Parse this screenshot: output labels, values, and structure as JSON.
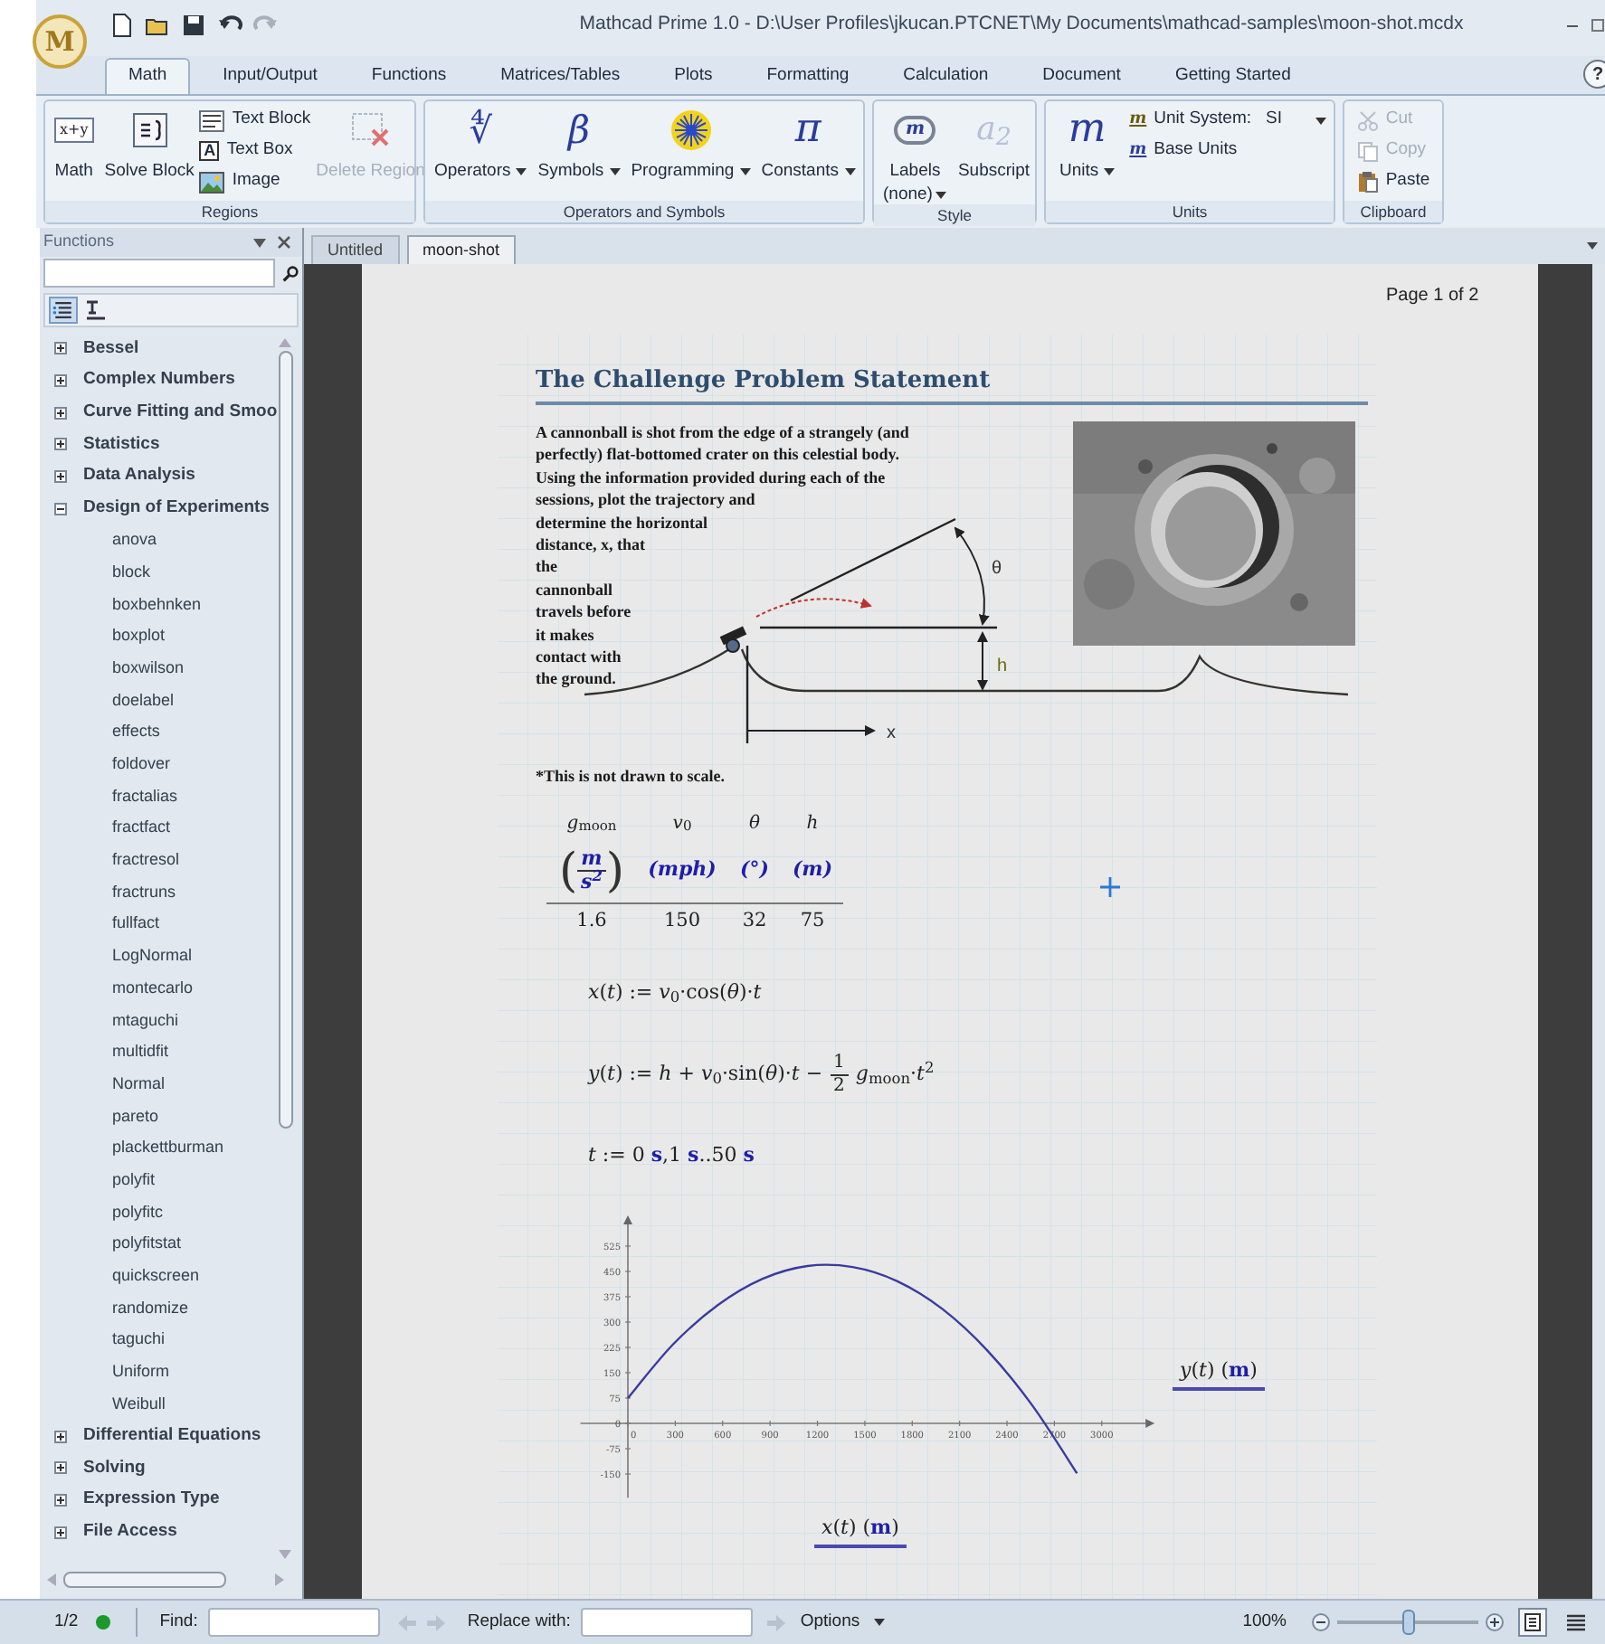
{
  "window": {
    "logo": "M",
    "title": "Mathcad Prime 1.0 - D:\\User Profiles\\jkucan.PTCNET\\My Documents\\mathcad-samples\\moon-shot.mcdx"
  },
  "quick_access": [
    {
      "kind": "new",
      "disabled": false
    },
    {
      "kind": "open",
      "disabled": false
    },
    {
      "kind": "save",
      "disabled": false
    },
    {
      "kind": "undo",
      "disabled": false
    },
    {
      "kind": "redo",
      "disabled": true
    }
  ],
  "ribbon_tabs": [
    {
      "label": "Math",
      "selected": true
    },
    {
      "label": "Input/Output",
      "selected": false
    },
    {
      "label": "Functions",
      "selected": false
    },
    {
      "label": "Matrices/Tables",
      "selected": false
    },
    {
      "label": "Plots",
      "selected": false
    },
    {
      "label": "Formatting",
      "selected": false
    },
    {
      "label": "Calculation",
      "selected": false
    },
    {
      "label": "Document",
      "selected": false
    },
    {
      "label": "Getting Started",
      "selected": false
    }
  ],
  "help": "?",
  "ribbon_groups": [
    {
      "label": "Regions",
      "items": [
        {
          "kind": "large",
          "glyph": "x+y",
          "label": "Math",
          "disabled": false,
          "dropdown": false
        },
        {
          "kind": "large",
          "label": "Solve Block",
          "disabled": false,
          "dropdown": false
        },
        {
          "kind": "stack",
          "items": [
            {
              "label": "Text Block",
              "disabled": false,
              "dropdown": false
            },
            {
              "glyph": "A",
              "label": "Text Box",
              "disabled": false,
              "dropdown": false
            },
            {
              "label": "Image",
              "disabled": false,
              "dropdown": false
            }
          ]
        },
        {
          "kind": "large",
          "label": "Delete Region",
          "disabled": true,
          "dropdown": false
        }
      ]
    },
    {
      "label": "Operators and Symbols",
      "items": [
        {
          "kind": "large",
          "glyph": "∜",
          "label": "Operators",
          "disabled": false,
          "dropdown": true
        },
        {
          "kind": "large",
          "glyph": "β",
          "label": "Symbols",
          "disabled": false,
          "dropdown": true
        },
        {
          "kind": "large",
          "label": "Programming",
          "disabled": false,
          "dropdown": true
        },
        {
          "kind": "large",
          "glyph": "π",
          "label": "Constants",
          "disabled": false,
          "dropdown": true
        }
      ]
    },
    {
      "label": "Style",
      "items": [
        {
          "kind": "large",
          "glyph": "m",
          "label": "Labels",
          "value": "(none)",
          "disabled": false,
          "dropdown": true
        },
        {
          "kind": "large",
          "glyph": "a$_{2}$",
          "label": "Subscript",
          "disabled": false,
          "dropdown": false
        }
      ]
    },
    {
      "label": "Units",
      "items": [
        {
          "kind": "large",
          "glyph": "m",
          "label": "Units",
          "disabled": false,
          "dropdown": true
        },
        {
          "kind": "stack",
          "items": [
            {
              "glyph": "m",
              "label": "Unit System:",
              "value": "SI",
              "disabled": false,
              "dropdown": true
            },
            {
              "glyph": "m",
              "label": "Base Units",
              "disabled": false,
              "dropdown": false
            }
          ]
        }
      ]
    },
    {
      "label": "Clipboard",
      "items": [
        {
          "kind": "stack",
          "items": [
            {
              "label": "Cut",
              "disabled": true,
              "dropdown": false
            },
            {
              "label": "Copy",
              "disabled": true,
              "dropdown": false
            },
            {
              "label": "Paste",
              "disabled": false,
              "dropdown": false
            }
          ]
        }
      ]
    }
  ],
  "functions_panel": {
    "title": "Functions",
    "view_toggles": [
      {
        "selected": true
      },
      {
        "selected": false
      }
    ],
    "tree": [
      {
        "label": "Bessel",
        "expanded": false
      },
      {
        "label": "Complex Numbers",
        "expanded": false
      },
      {
        "label": "Curve Fitting and Smoo",
        "expanded": false
      },
      {
        "label": "Statistics",
        "expanded": false
      },
      {
        "label": "Data Analysis",
        "expanded": false
      },
      {
        "label": "Design of Experiments",
        "expanded": true,
        "children": [
          {
            "label": "anova"
          },
          {
            "label": "block"
          },
          {
            "label": "boxbehnken"
          },
          {
            "label": "boxplot"
          },
          {
            "label": "boxwilson"
          },
          {
            "label": "doelabel"
          },
          {
            "label": "effects"
          },
          {
            "label": "foldover"
          },
          {
            "label": "fractalias"
          },
          {
            "label": "fractfact"
          },
          {
            "label": "fractresol"
          },
          {
            "label": "fractruns"
          },
          {
            "label": "fullfact"
          },
          {
            "label": "LogNormal"
          },
          {
            "label": "montecarlo"
          },
          {
            "label": "mtaguchi"
          },
          {
            "label": "multidfit"
          },
          {
            "label": "Normal"
          },
          {
            "label": "pareto"
          },
          {
            "label": "plackettburman"
          },
          {
            "label": "polyfit"
          },
          {
            "label": "polyfitc"
          },
          {
            "label": "polyfitstat"
          },
          {
            "label": "quickscreen"
          },
          {
            "label": "randomize"
          },
          {
            "label": "taguchi"
          },
          {
            "label": "Uniform"
          },
          {
            "label": "Weibull"
          }
        ]
      },
      {
        "label": "Differential Equations",
        "expanded": false
      },
      {
        "label": "Solving",
        "expanded": false
      },
      {
        "label": "Expression Type",
        "expanded": false
      },
      {
        "label": "File Access",
        "expanded": false
      }
    ]
  },
  "document_tabs": [
    {
      "label": "Untitled",
      "selected": false
    },
    {
      "label": "moon-shot",
      "selected": true
    }
  ],
  "page": {
    "page_label": "Page 1 of 2",
    "heading": "The Challenge Problem Statement",
    "paragraph": "A cannonball is shot from the edge of a strangely (and perfectly) flat-bottomed crater on this celestial body. Using the information provided during each of the sessions, plot the trajectory and determine the horizontal distance, x, that the cannonball travels before it makes contact with the ground.",
    "diagram": {
      "angle_label": "θ",
      "height_label": "h",
      "distance_label": "x"
    },
    "note": "*This is not drawn to scale.",
    "table": {
      "columns": [
        {
          "name": "*g*$_{moon}$",
          "unit": {
            "kind": "fraction",
            "open": "(",
            "numerator": "m",
            "denominator": "s$^{2}$",
            "close": ")"
          },
          "value": "1.6"
        },
        {
          "name": "*v*$_{0}$",
          "unit": {
            "kind": "plain",
            "text": "(mph)"
          },
          "value": "150"
        },
        {
          "name": "*θ*",
          "unit": {
            "kind": "plain",
            "text": "(°)"
          },
          "value": "32"
        },
        {
          "name": "*h*",
          "unit": {
            "kind": "plain",
            "text": "(m)"
          },
          "value": "75"
        }
      ]
    },
    "equations": [
      {
        "kind": "plain",
        "text": "*x*(*t*) := *v*$_{0}$·cos(*θ*)·*t*"
      },
      {
        "kind": "fraction",
        "before": "*y*(*t*) := *h* + *v*$_{0}$·sin(*θ*)·*t* −",
        "numerator": "1",
        "denominator": "2",
        "after": "*g*$_{moon}$·*t*$^{2}$"
      },
      {
        "kind": "plain",
        "text": "*t* := 0 **s**,1 **s**..50 **s**"
      }
    ],
    "chart_data": {
      "type": "line",
      "xlabel": "*x*(*t*)  (**m**)",
      "ylabel": "*y*(*t*)  (**m**)",
      "x": [
        0,
        284,
        569,
        853,
        1137,
        1422,
        1706,
        1990,
        2275,
        2559,
        2843
      ],
      "series": [
        {
          "color": "#3a3aa0",
          "values": [
            75,
            233,
            350,
            428,
            466,
            463,
            421,
            339,
            216,
            54,
            -148
          ]
        }
      ],
      "xlim": [
        -300,
        3300
      ],
      "ylim": [
        -220,
        600
      ],
      "xticks": [
        0,
        300,
        600,
        900,
        1200,
        1500,
        1800,
        2100,
        2400,
        2700,
        3000
      ],
      "yticks": [
        -150,
        -75,
        0,
        75,
        150,
        225,
        300,
        375,
        450,
        525
      ]
    }
  },
  "status_bar": {
    "page": "1/2",
    "find_label": "Find:",
    "replace_label": "Replace with:",
    "options": "Options",
    "zoom": "100%",
    "zoom_slider": {
      "level": 0.5
    },
    "view_toggles": [
      {
        "selected": true
      },
      {
        "selected": false
      }
    ]
  }
}
